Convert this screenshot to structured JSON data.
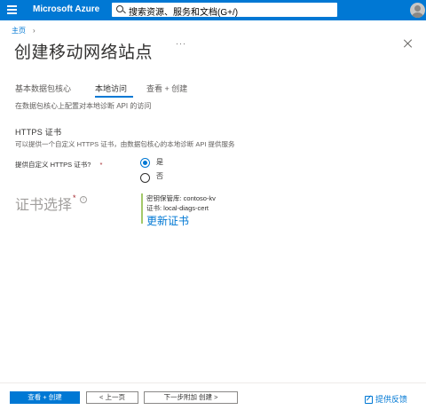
{
  "topbar": {
    "brand": "Microsoft Azure",
    "search_placeholder": "搜索资源、服务和文档(G+/)",
    "accent_color": "#0078d4"
  },
  "breadcrumb": {
    "home": "主页",
    "separator": "›"
  },
  "page": {
    "title": "创建移动网络站点",
    "more": "···"
  },
  "tabs": [
    {
      "label": "基本数据包核心",
      "active": false
    },
    {
      "label": "本地访问",
      "active": true
    },
    {
      "label": "查看 + 创建",
      "active": false
    }
  ],
  "local_access": {
    "description": "在数据包核心上配置对本地诊断 API 的访问",
    "https_section": {
      "title": "HTTPS 证书",
      "description": "可以提供一个自定义 HTTPS 证书，由数据包核心的本地诊断 API 提供服务"
    },
    "custom_cert_question": {
      "label": "提供自定义 HTTPS 证书?",
      "required_mark": "*",
      "options": [
        {
          "label": "是",
          "selected": true
        },
        {
          "label": "否",
          "selected": false
        }
      ]
    },
    "cert_selection": {
      "label": "证书选择",
      "required_mark": "*",
      "info_icon": "i",
      "key_vault": "密钥保管库: contoso-kv",
      "certificate": "证书: local-diags-cert",
      "change_link": "更新证书"
    }
  },
  "footer": {
    "review_create": "查看 + 创建",
    "previous": "< 上一页",
    "next": "下一步附加 创建 >",
    "feedback": "提供反馈"
  }
}
